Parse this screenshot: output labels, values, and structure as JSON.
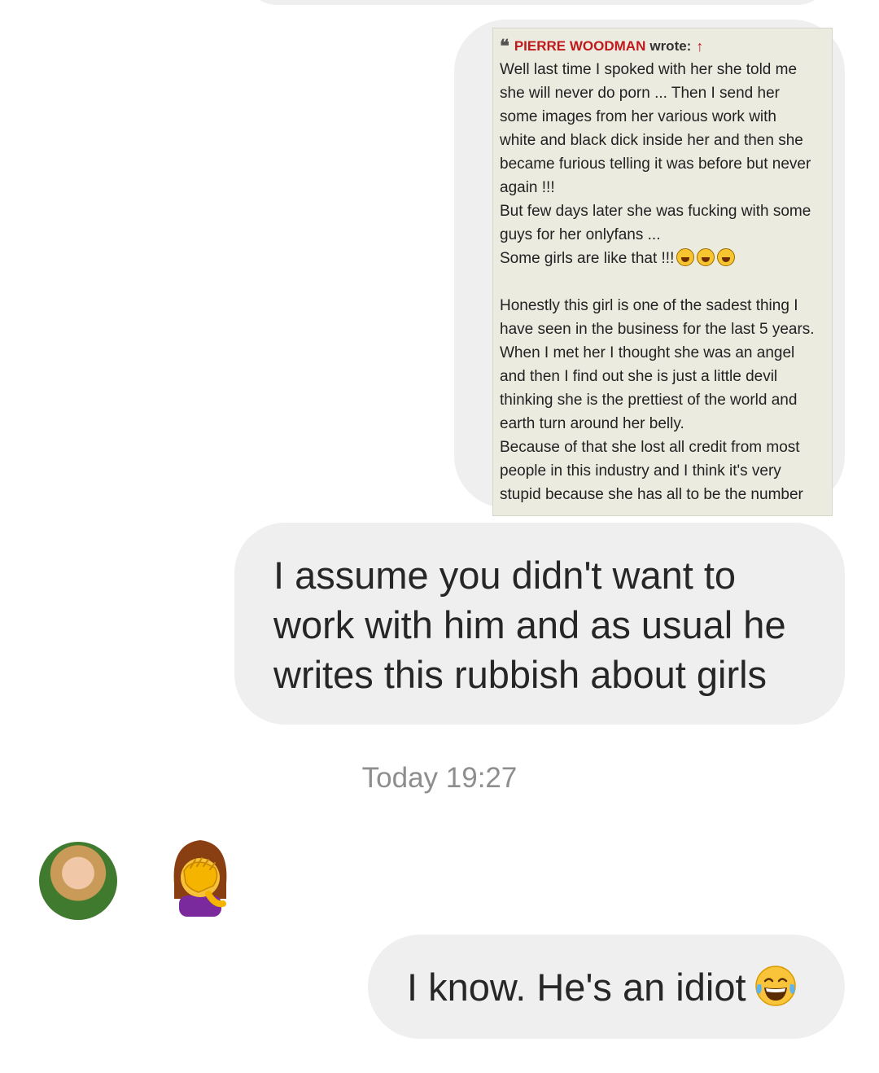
{
  "quote": {
    "author": "PIERRE WOODMAN",
    "wrote_label": "wrote:",
    "lines": [
      "Well last time I spoked with her she told me",
      "she will never do porn ... Then I send her",
      "some images from her various work with",
      "white and black dick inside her and then she",
      "became furious telling it was before but never",
      "again !!!",
      "But few days later she was fucking with some",
      "guys for her onlyfans ...",
      "Some girls are like that !!!"
    ],
    "lines2": [
      "Honestly this girl is one of the sadest thing I",
      "have seen in the business for the last 5 years.",
      "When I met her I thought she was an angel",
      "and then I find out she is just a little devil",
      "thinking she is the prettiest of the world and",
      "earth turn around her belly.",
      "Because of that she lost all credit from most",
      "people in this industry and I think it's very",
      "stupid because she has all to be the number"
    ]
  },
  "messages": {
    "sent_1": "I assume you didn't want to work with him and as usual he writes this rubbish about girls",
    "timestamp": "Today 19:27",
    "sent_2": "I know. He's an idiot"
  },
  "icons": {
    "quote_mark": "quote-icon",
    "arrow": "up-arrow-icon",
    "laugh": "tears-of-joy-emoji",
    "facepalm": "facepalm-emoji"
  },
  "colors": {
    "bubble": "#efefef",
    "quote_author": "#c0191c",
    "timestamp": "#8e8e8e"
  }
}
